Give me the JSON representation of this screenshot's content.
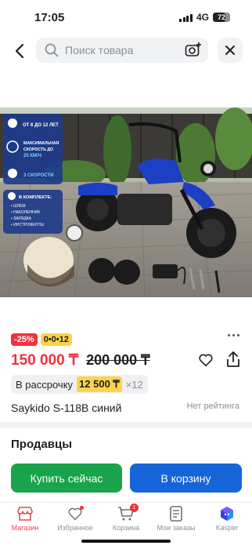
{
  "status": {
    "time": "17:05",
    "network": "4G",
    "battery": "72",
    "battery_level": 0.72
  },
  "search": {
    "placeholder": "Поиск товара"
  },
  "image": {
    "alt": "Saykido S-118B синий",
    "info_lines": [
      "ОТ 6 ДО 12 ЛЕТ",
      "МАКСИМАЛЬНАЯ",
      "СКОРОСТЬ ДО",
      "25 КМ/Ч",
      "3 СКОРОСТИ",
      "В КОМПЛЕКТЕ:",
      "• ШЛЕМ",
      "• НАКОЛЕННИК",
      "• ЗАРЯДКА",
      "• ИНСТРУМЕНТЫ"
    ]
  },
  "product": {
    "discount": "-25%",
    "installment_badge": "0•0•12",
    "price": "150 000 ₸",
    "old_price": "200 000 ₸",
    "installment_label": "В рассрочку",
    "installment_amount": "12 500 ₸",
    "installment_multiplier": "×12",
    "name": "Saykido S-118B синий",
    "rating": "Нет рейтинга"
  },
  "sellers": {
    "title": "Продавцы"
  },
  "actions": {
    "buy_now": "Купить сейчас",
    "add_to_cart": "В корзину"
  },
  "tabbar": {
    "items": [
      {
        "label": "Магазин",
        "icon": "shop-icon"
      },
      {
        "label": "Избранное",
        "icon": "heart-icon"
      },
      {
        "label": "Корзина",
        "icon": "cart-icon"
      },
      {
        "label": "Мои заказы",
        "icon": "orders-icon"
      },
      {
        "label": "Kasper",
        "icon": "kasper-icon"
      }
    ],
    "cart_count": "1"
  },
  "colors": {
    "accent_red": "#f0323c",
    "buy_green": "#19a34a",
    "cart_blue": "#1565d8",
    "installment_yellow": "#fcd34d"
  }
}
